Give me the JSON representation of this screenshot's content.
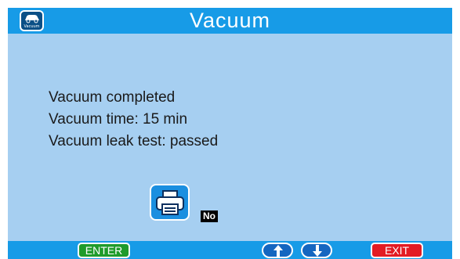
{
  "title": "Vacuum",
  "app_icon": {
    "caption": "Vacuum",
    "icon": "car-vacuum-icon"
  },
  "messages": [
    "Vacuum completed",
    "Vacuum time: 15 min",
    "Vacuum leak test: passed"
  ],
  "print": {
    "icon": "printer-icon",
    "value": "No"
  },
  "footer": {
    "enter_label": "ENTER",
    "up_icon": "arrow-up-icon",
    "down_icon": "arrow-down-icon",
    "exit_label": "EXIT"
  },
  "colors": {
    "background": "#a6cff1",
    "bars": "#179be7",
    "enter": "#1f9b2b",
    "exit": "#e31b23",
    "arrows": "#1566c0"
  }
}
